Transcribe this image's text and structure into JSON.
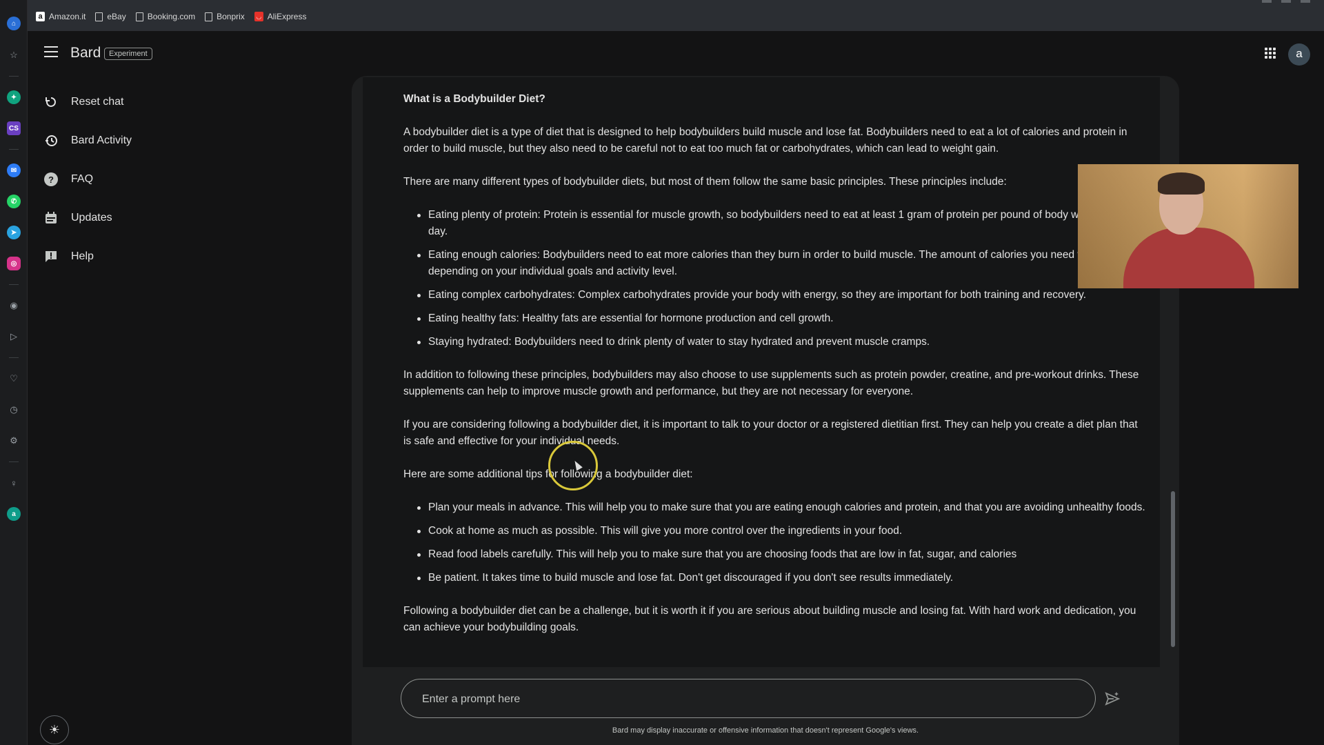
{
  "bookmarks": [
    {
      "label": "Amazon.it",
      "icon": "amazon-icon"
    },
    {
      "label": "eBay",
      "icon": "page-icon"
    },
    {
      "label": "Booking.com",
      "icon": "page-icon"
    },
    {
      "label": "Bonprix",
      "icon": "page-icon"
    },
    {
      "label": "AliExpress",
      "icon": "aliexpress-icon"
    }
  ],
  "header": {
    "brand": "Bard",
    "badge": "Experiment",
    "avatar_letter": "a"
  },
  "sidebar": {
    "items": [
      {
        "label": "Reset chat",
        "icon": "reset-icon"
      },
      {
        "label": "Bard Activity",
        "icon": "history-icon"
      },
      {
        "label": "FAQ",
        "icon": "help-circle-icon"
      },
      {
        "label": "Updates",
        "icon": "calendar-icon"
      },
      {
        "label": "Help",
        "icon": "feedback-icon"
      }
    ]
  },
  "response": {
    "heading": "What is a Bodybuilder Diet?",
    "p1": "A bodybuilder diet is a type of diet that is designed to help bodybuilders build muscle and lose fat. Bodybuilders need to eat a lot of calories and protein in order to build muscle, but they also need to be careful not to eat too much fat or carbohydrates, which can lead to weight gain.",
    "p2": "There are many different types of bodybuilder diets, but most of them follow the same basic principles. These principles include:",
    "principles": [
      "Eating plenty of protein: Protein is essential for muscle growth, so bodybuilders need to eat at least 1 gram of protein per pound of body weight each day.",
      "Eating enough calories: Bodybuilders need to eat more calories than they burn in order to build muscle. The amount of calories you need will vary depending on your individual goals and activity level.",
      "Eating complex carbohydrates: Complex carbohydrates provide your body with energy, so they are important for both training and recovery.",
      "Eating healthy fats: Healthy fats are essential for hormone production and cell growth.",
      "Staying hydrated: Bodybuilders need to drink plenty of water to stay hydrated and prevent muscle cramps."
    ],
    "p3": "In addition to following these principles, bodybuilders may also choose to use supplements such as protein powder, creatine, and pre-workout drinks. These supplements can help to improve muscle growth and performance, but they are not necessary for everyone.",
    "p4": "If you are considering following a bodybuilder diet, it is important to talk to your doctor or a registered dietitian first. They can help you create a diet plan that is safe and effective for your individual needs.",
    "p5": "Here are some additional tips for following a bodybuilder diet:",
    "tips": [
      "Plan your meals in advance. This will help you to make sure that you are eating enough calories and protein, and that you are avoiding unhealthy foods.",
      "Cook at home as much as possible. This will give you more control over the ingredients in your food.",
      "Read food labels carefully. This will help you to make sure that you are choosing foods that are low in fat, sugar, and calories",
      "Be patient. It takes time to build muscle and lose fat. Don't get discouraged if you don't see results immediately."
    ],
    "p6": "Following a bodybuilder diet can be a challenge, but it is worth it if you are serious about building muscle and losing fat. With hard work and dedication, you can achieve your bodybuilding goals."
  },
  "prompt": {
    "placeholder": "Enter a prompt here",
    "value": ""
  },
  "disclaimer": "Bard may display inaccurate or offensive information that doesn't represent Google's views.",
  "colors": {
    "background": "#131314",
    "panel": "#1e1f20",
    "text": "#e3e3e3",
    "cursor_highlight": "#d9c83a"
  }
}
